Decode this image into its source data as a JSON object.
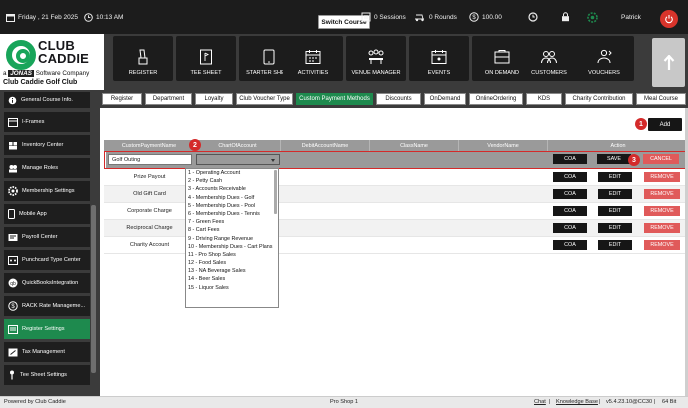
{
  "topbar": {
    "date": "Friday , 21 Feb 2025",
    "time": "10:13 AM",
    "switch_course": "Switch Course",
    "sessions": "0 Sessions",
    "rounds": "0 Rounds",
    "amount": "100.00",
    "user": "Patrick"
  },
  "logo": {
    "brand_line1": "CLUB",
    "brand_line2": "CADDIE",
    "tagline_prefix": "a",
    "tagline_brand": "JONAS",
    "tagline_suffix": "Software Company",
    "club_name": "Club Caddie Golf Club"
  },
  "modules": [
    {
      "label": "REGISTER",
      "icon": "register-icon"
    },
    {
      "label": "TEE SHEET",
      "icon": "tee-sheet-icon"
    },
    {
      "label": "STARTER SHEET",
      "icon": "tablet-icon"
    },
    {
      "label": "ACTIVITIES",
      "icon": "calendar-icon"
    },
    {
      "label": "VENUE MANAGER",
      "icon": "venue-icon"
    },
    {
      "label": "EVENTS",
      "icon": "events-calendar-icon"
    },
    {
      "label": "ON DEMAND",
      "icon": "on-demand-icon"
    },
    {
      "label": "CUSTOMERS",
      "icon": "customers-icon"
    },
    {
      "label": "VOUCHERS",
      "icon": "voucher-icon"
    }
  ],
  "sidebar": {
    "items": [
      {
        "label": "General Course Info."
      },
      {
        "label": "I-Frames"
      },
      {
        "label": "Inventory Center"
      },
      {
        "label": "Manage Roles"
      },
      {
        "label": "Membership Settings"
      },
      {
        "label": "Mobile App"
      },
      {
        "label": "Payroll Center"
      },
      {
        "label": "Punchcard Type Center"
      },
      {
        "label": "QuickBooksIntegration"
      },
      {
        "label": "RACK Rate Manageme..."
      },
      {
        "label": "Register Settings"
      },
      {
        "label": "Tax Management"
      },
      {
        "label": "Tee Sheet Settings"
      }
    ]
  },
  "tabs": [
    "Register",
    "Department",
    "Loyalty",
    "Club Voucher Type",
    "Custom Payment Methods",
    "Discounts",
    "OnDemand",
    "OnlineOrdering",
    "KDS",
    "Charity Contribution",
    "Meal Course"
  ],
  "active_tab": "Custom Payment Methods",
  "content": {
    "add_label": "Add",
    "badges": [
      "1",
      "2",
      "3"
    ],
    "columns": [
      "CustomPaymentName",
      "ChartOfAccount",
      "DebitAccountName",
      "ClassName",
      "VendorName",
      "Action"
    ],
    "edit_row": {
      "name_value": "Golf Outing",
      "coa": "COA",
      "save": "SAVE",
      "cancel": "CANCEL"
    },
    "rows": [
      {
        "name": "Prize Payout"
      },
      {
        "name": "Old Gift Card"
      },
      {
        "name": "Corporate Charge"
      },
      {
        "name": "Reciprocal Charge"
      },
      {
        "name": "Charity Account"
      }
    ],
    "row_buttons": {
      "coa": "COA",
      "edit": "EDIT",
      "remove": "REMOVE"
    }
  },
  "dropdown_options": [
    "1 - Operating Account",
    "2 - Petty Cash",
    "3 - Accounts Receivable",
    "4 - Membership Dues - Golf",
    "5 - Membership Dues - Pool",
    "6 - Membership Dues - Tennis",
    "7 - Green Fees",
    "8 - Cart Fees",
    "9 - Driving Range Revenue",
    "10 - Membership Dues - Cart Plans",
    "11 - Pro Shop Sales",
    "12 - Food Sales",
    "13 - NA Beverage Sales",
    "14 - Beer Sales",
    "15 - Liquor Sales"
  ],
  "footer": {
    "powered": "Powered by Club Caddie",
    "station": "Pro Shop 1",
    "chat": "Chat",
    "sep1": "|",
    "kb": "Knowledge Base",
    "sep2": "|",
    "version": "v5.4.23.10@CC30",
    "sep3": "|",
    "bits": "64 Bit"
  },
  "colors": {
    "accent_green": "#1e8a4e",
    "alert_red": "#d42a2a",
    "dark": "#1c1c1c"
  }
}
